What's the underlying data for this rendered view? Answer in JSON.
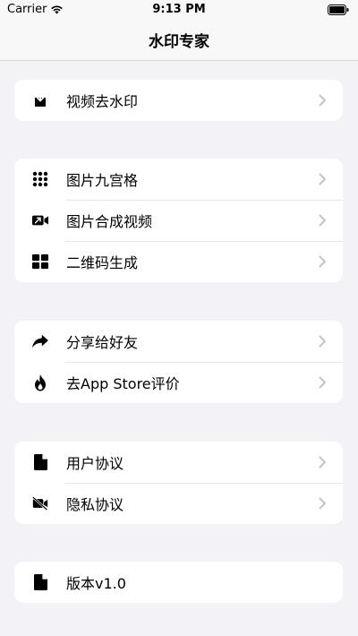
{
  "status": {
    "carrier": "Carrier",
    "time": "9:13 PM"
  },
  "nav": {
    "title": "水印专家"
  },
  "groups": [
    {
      "items": [
        {
          "label": "视频去水印",
          "icon": "download-box-icon"
        }
      ]
    },
    {
      "items": [
        {
          "label": "图片九宫格",
          "icon": "grid-dots-icon"
        },
        {
          "label": "图片合成视频",
          "icon": "video-arrow-icon"
        },
        {
          "label": "二维码生成",
          "icon": "qr-blocks-icon"
        }
      ]
    },
    {
      "items": [
        {
          "label": "分享给好友",
          "icon": "share-arrow-icon"
        },
        {
          "label": "去App Store评价",
          "icon": "flame-icon"
        }
      ]
    },
    {
      "items": [
        {
          "label": "用户协议",
          "icon": "document-icon"
        },
        {
          "label": "隐私协议",
          "icon": "camera-off-icon"
        }
      ]
    },
    {
      "items": [
        {
          "label": "版本v1.0",
          "icon": "document-icon"
        }
      ]
    }
  ],
  "colors": {
    "background": "#f2f2f7",
    "card": "#ffffff",
    "chevron": "#c4c4c7",
    "icon": "#000000"
  }
}
